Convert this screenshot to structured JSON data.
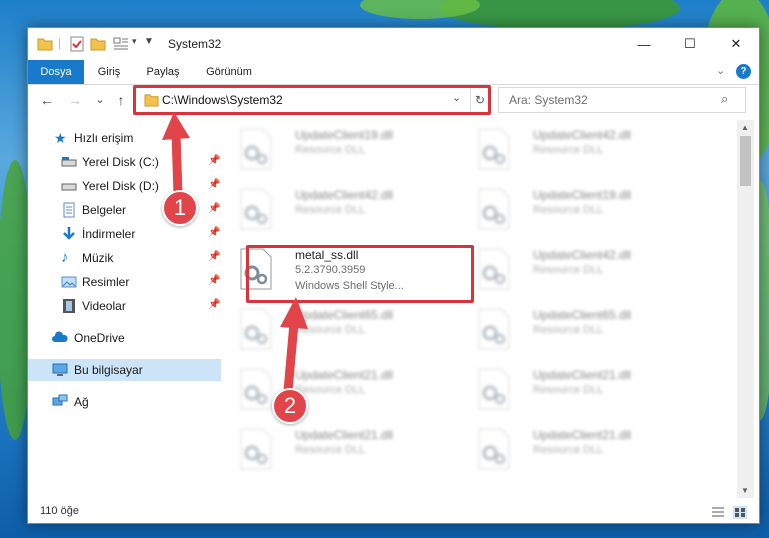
{
  "window": {
    "title": "System32",
    "minimize": "—",
    "maximize": "☐",
    "close": "✕"
  },
  "ribbon": {
    "tabs": [
      {
        "label": "Dosya",
        "active": true
      },
      {
        "label": "Giriş",
        "active": false
      },
      {
        "label": "Paylaş",
        "active": false
      },
      {
        "label": "Görünüm",
        "active": false
      }
    ],
    "help": "?"
  },
  "address": {
    "path": "C:\\Windows\\System32",
    "back": "←",
    "forward": "→",
    "recent": "⌄",
    "up": "↑",
    "refresh": "↻"
  },
  "search": {
    "placeholder": "Ara: System32"
  },
  "sidebar": {
    "items": [
      {
        "label": "Hızlı erişim",
        "icon": "star-icon"
      },
      {
        "label": "Yerel Disk (C:)",
        "icon": "drive-icon",
        "pinned": true
      },
      {
        "label": "Yerel Disk (D:)",
        "icon": "drive-icon",
        "pinned": true
      },
      {
        "label": "Belgeler",
        "icon": "documents-icon",
        "pinned": true
      },
      {
        "label": "İndirmeler",
        "icon": "download-icon",
        "pinned": true
      },
      {
        "label": "Müzik",
        "icon": "music-icon",
        "pinned": true
      },
      {
        "label": "Resimler",
        "icon": "pictures-icon",
        "pinned": true
      },
      {
        "label": "Videolar",
        "icon": "video-icon",
        "pinned": true
      },
      {
        "label": "OneDrive",
        "icon": "cloud-icon"
      },
      {
        "label": "Bu bilgisayar",
        "icon": "computer-icon",
        "selected": true
      },
      {
        "label": "Ağ",
        "icon": "network-icon"
      }
    ]
  },
  "files": {
    "left": [
      {
        "name": "UpdateClient19.dll",
        "desc": "Resource DLL"
      },
      {
        "name": "UpdateClient42.dll",
        "desc": "Resource DLL"
      },
      {
        "name": "metal_ss.dll",
        "version": "5.2.3790.3959",
        "desc": "Windows Shell Style...",
        "highlighted": true
      },
      {
        "name": "UpdateClient65.dll",
        "desc": "Resource DLL"
      },
      {
        "name": "UpdateClient21.dll",
        "desc": "Resource DLL"
      },
      {
        "name": "UpdateClient21.dll",
        "desc": "Resource DLL"
      }
    ],
    "right": [
      {
        "name": "UpdateClient42.dll",
        "desc": "Resource DLL"
      },
      {
        "name": "UpdateClient19.dll",
        "desc": "Resource DLL"
      },
      {
        "name": "UpdateClient42.dll",
        "desc": "Resource DLL"
      },
      {
        "name": "UpdateClient65.dll",
        "desc": "Resource DLL"
      },
      {
        "name": "UpdateClient21.dll",
        "desc": "Resource DLL"
      },
      {
        "name": "UpdateClient21.dll",
        "desc": "Resource DLL"
      }
    ]
  },
  "status": {
    "count": "110 öğe"
  },
  "callouts": [
    "1",
    "2"
  ],
  "colors": {
    "accent": "#1979ca",
    "highlight": "#d9343a",
    "selected": "#cce4f7"
  }
}
